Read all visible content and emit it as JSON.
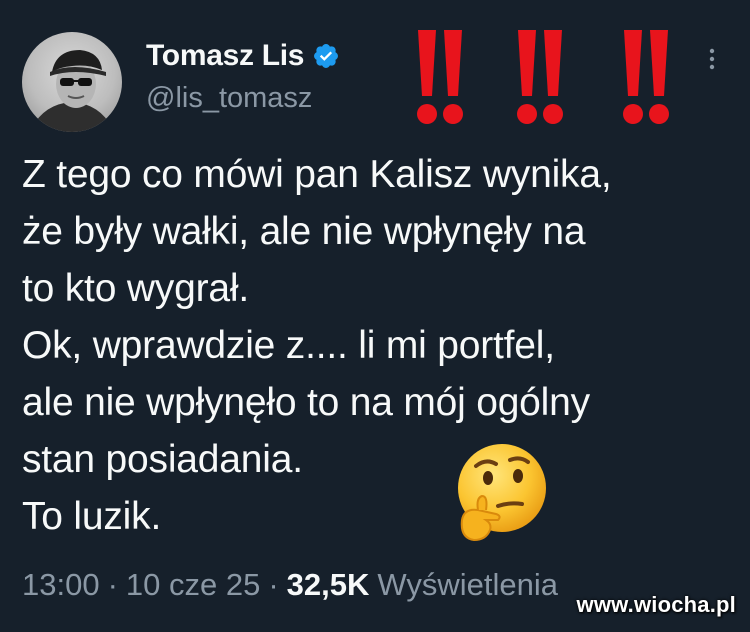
{
  "author": {
    "display_name": "Tomasz Lis",
    "handle": "@lis_tomasz",
    "verified": true
  },
  "decoration": {
    "exclamations": "!! !! !!",
    "exclamation_color": "#e8141c"
  },
  "body": {
    "lines": [
      "Z tego co mówi pan Kalisz wynika,",
      "że były wałki, ale nie wpłynęły na",
      "to kto wygrał.",
      "Ok, wprawdzie z.... li mi portfel,",
      "ale nie wpłynęło to na mój ogólny",
      "stan posiadania.",
      "To luzik."
    ],
    "emoji": "thinking-face"
  },
  "meta": {
    "time": "13:00",
    "separator": "·",
    "date": "10 cze 25",
    "views_count": "32,5K",
    "views_label": "Wyświetlenia"
  },
  "watermark": "www.wiocha.pl",
  "colors": {
    "background": "#16202b",
    "text_primary": "#f7f9f9",
    "text_secondary": "#8b98a5",
    "verified_blue": "#1d9bf0"
  }
}
